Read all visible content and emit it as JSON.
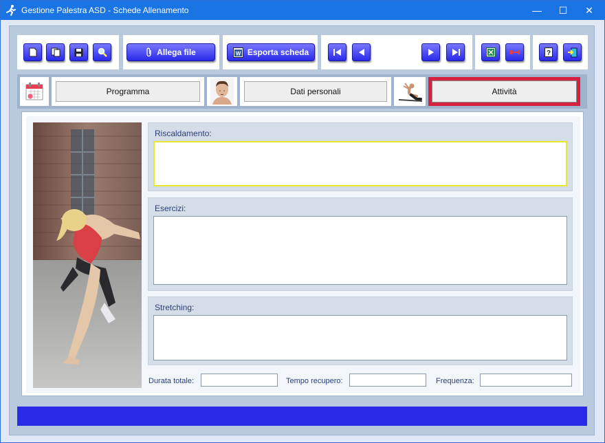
{
  "window": {
    "title": "Gestione Palestra ASD - Schede Allenamento",
    "controls": {
      "minimize": "—",
      "maximize": "☐",
      "close": "✕"
    }
  },
  "toolbar": {
    "file_buttons": [
      {
        "name": "new-document-button",
        "icon": "new-document-icon"
      },
      {
        "name": "copy-button",
        "icon": "copy-icon"
      },
      {
        "name": "save-button",
        "icon": "floppy-disk-icon"
      },
      {
        "name": "search-button",
        "icon": "magnifier-icon"
      }
    ],
    "attach_label": "Allega file",
    "export_label": "Esporta scheda",
    "nav_buttons": [
      {
        "name": "first-record-button",
        "icon": "skip-first-icon"
      },
      {
        "name": "prev-record-button",
        "icon": "arrow-left-icon"
      },
      {
        "name": "next-record-button",
        "icon": "arrow-right-icon"
      },
      {
        "name": "last-record-button",
        "icon": "skip-last-icon"
      }
    ],
    "tool_buttons": [
      {
        "name": "excel-export-button",
        "icon": "excel-icon"
      },
      {
        "name": "dumbbell-button",
        "icon": "dumbbell-icon"
      }
    ],
    "help_buttons": [
      {
        "name": "help-button",
        "icon": "question-icon"
      },
      {
        "name": "exit-button",
        "icon": "exit-door-icon"
      }
    ]
  },
  "tabs": [
    {
      "label": "Programma",
      "icon": "calendar-icon",
      "active": false
    },
    {
      "label": "Dati personali",
      "icon": "man-portrait-icon",
      "active": false
    },
    {
      "label": "Attività",
      "icon": "workout-figure-icon",
      "active": true
    }
  ],
  "form": {
    "warmup": {
      "label": "Riscaldamento:",
      "value": ""
    },
    "exercises": {
      "label": "Esercizi:",
      "value": ""
    },
    "stretching": {
      "label": "Stretching:",
      "value": ""
    },
    "total_duration": {
      "label": "Durata totale:",
      "value": ""
    },
    "recovery_time": {
      "label": "Tempo recupero:",
      "value": ""
    },
    "frequency": {
      "label": "Frequenza:",
      "value": ""
    }
  },
  "colors": {
    "titlebar": "#1b74e4",
    "button_blue": "#2a2ae8",
    "active_tab_border": "#d82040",
    "focus_border": "#e8e830",
    "statusbar": "#2a2ae6",
    "label_text": "#2a3f78"
  }
}
